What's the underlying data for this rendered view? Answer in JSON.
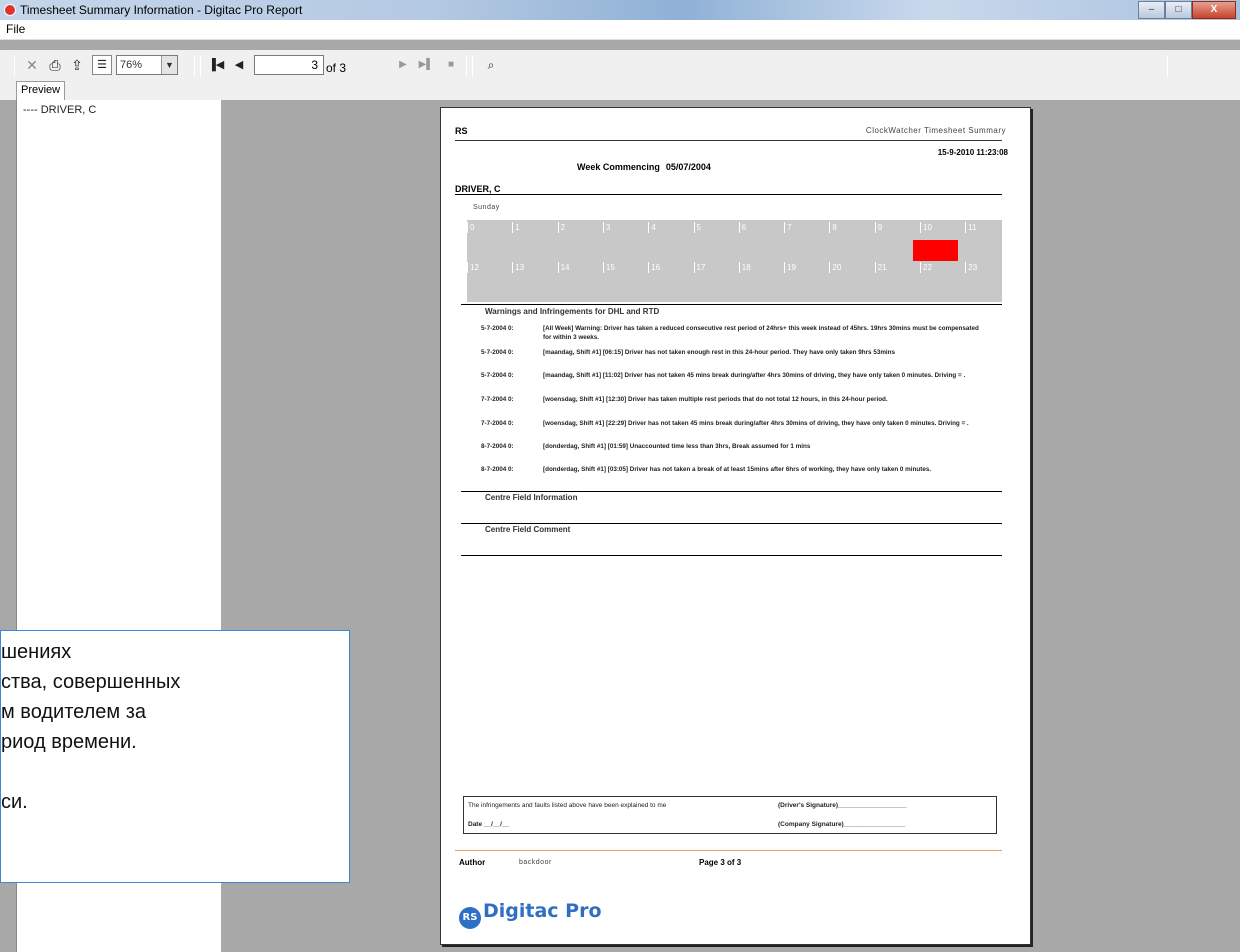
{
  "window": {
    "title": "Timesheet Summary Information - Digitac Pro Report",
    "minimize": "–",
    "maximize": "□",
    "close": "X"
  },
  "menu": {
    "file": "File"
  },
  "toolbar": {
    "zoom": "76%",
    "page_current": "3",
    "page_total": "of 3",
    "icons": [
      "close-icon",
      "print-icon",
      "export-icon",
      "tree-toggle-icon",
      "first-page-icon",
      "prev-page-icon",
      "next-page-icon",
      "last-page-icon",
      "stop-icon",
      "find-icon"
    ]
  },
  "tabs": {
    "preview": "Preview"
  },
  "tree": {
    "item": "---- DRIVER, C"
  },
  "report": {
    "header_left": "RS",
    "header_right": "ClockWatcher Timesheet Summary",
    "datetime": "15-9-2010 11:23:08",
    "week_label": "Week Commencing",
    "week_date": "05/07/2004",
    "driver": "DRIVER, C",
    "day": "Sunday",
    "hours_row1": [
      "0",
      "1",
      "2",
      "3",
      "4",
      "5",
      "6",
      "7",
      "8",
      "9",
      "10",
      "11"
    ],
    "hours_row2": [
      "12",
      "13",
      "14",
      "15",
      "16",
      "17",
      "18",
      "19",
      "20",
      "21",
      "22",
      "23"
    ],
    "activity_color": "#ff0000",
    "warnings_title": "Warnings and Infringements for DHL and RTD",
    "warnings": [
      {
        "date": "5-7-2004  0:",
        "text": "[All Week] Warning: Driver has taken a reduced consecutive rest period of 24hrs+ this week instead of 45hrs. 19hrs 30mins must be compensated for within 3 weeks."
      },
      {
        "date": "5-7-2004  0:",
        "text": "[maandag, Shift #1] [06:15] Driver has not taken enough rest in this 24-hour period. They have only taken 9hrs 53mins"
      },
      {
        "date": "5-7-2004  0:",
        "text": "[maandag, Shift #1] [11:02] Driver has not taken 45 mins break during/after 4hrs 30mins of driving, they have only taken 0 minutes. Driving = ."
      },
      {
        "date": "7-7-2004  0:",
        "text": "[woensdag, Shift #1] [12:30] Driver has taken multiple rest periods that do not total 12 hours, in this 24-hour period."
      },
      {
        "date": "7-7-2004  0:",
        "text": "[woensdag, Shift #1] [22:29] Driver has not taken 45 mins break during/after 4hrs 30mins of driving, they have only taken 0 minutes. Driving = ."
      },
      {
        "date": "8-7-2004  0:",
        "text": "[donderdag, Shift #1] [01:59] Unaccounted time less than 3hrs, Break assumed for 1 mins"
      },
      {
        "date": "8-7-2004  0:",
        "text": "[donderdag, Shift #1] [03:05] Driver has not taken a break of at least 15mins after 6hrs of working, they have only taken 0 minutes."
      }
    ],
    "centre_info": "Centre Field Information",
    "centre_comment": "Centre Field Comment",
    "sig_statement": "The infringements and faults listed above have been explained to me",
    "driver_sig": "(Driver's Signature)___________________",
    "date_line": "Date __/__/__",
    "company_sig": "(Company Signature)_________________",
    "author_label": "Author",
    "author_value": "backdoor",
    "page_label": "Page 3 of 3",
    "logo_mark": "RS",
    "logo_text": "Digitac Pro"
  },
  "overlay": {
    "lines": [
      "шениях",
      "ства, совершенных",
      "м водителем за",
      "риод времени.",
      "",
      "си."
    ]
  }
}
